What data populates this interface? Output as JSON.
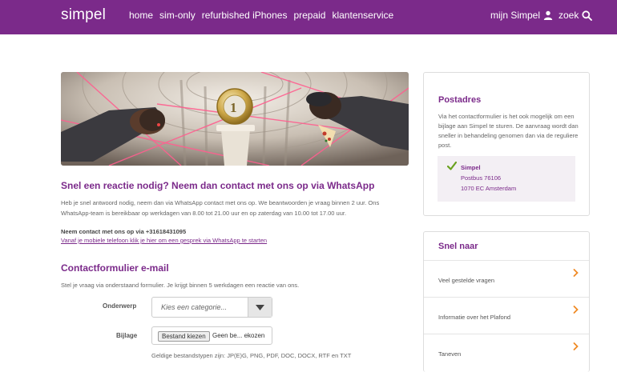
{
  "header": {
    "logo": "simpel",
    "nav": [
      "home",
      "sim-only",
      "refurbished iPhones",
      "prepaid",
      "klantenservice"
    ],
    "account_label": "mijn Simpel",
    "search_label": "zoek"
  },
  "whatsapp": {
    "title": "Snel een reactie nodig? Neem dan contact met ons op via WhatsApp",
    "intro": "Heb je snel antwoord nodig, neem dan via WhatsApp contact met ons op. We beantwoorden je vraag binnen 2 uur. Ons WhatsApp-team is bereikbaar op werkdagen van 8.00 tot 21.00 uur en op zaterdag van 10.00 tot 17.00 uur.",
    "contact": "Neem contact met ons op via +31618431095",
    "link": "Vanaf je mobiele telefoon klik je hier om een gesprek via WhatsApp te starten"
  },
  "form": {
    "title": "Contactformulier e-mail",
    "intro": "Stel je vraag via onderstaand formulier. Je krijgt binnen 5 werkdagen een reactie van ons.",
    "subject_label": "Onderwerp",
    "subject_placeholder": "Kies een categorie...",
    "attachment_label": "Bijlage",
    "file_button": "Bestand kiezen",
    "file_status": "Geen be... ekozen",
    "file_types": "Geldige bestandstypen zijn: JP(E)G, PNG, PDF, DOC, DOCX, RTF en TXT"
  },
  "postadres": {
    "title": "Postadres",
    "text": "Via het contactformulier is het ook mogelijk om een bijlage aan Simpel te sturen. De aanvraag wordt dan sneller in behandeling genomen dan via de reguliere post.",
    "name": "Simpel",
    "line1": "Postbus 76106",
    "line2": "1070 EC Amsterdam"
  },
  "snel_naar": {
    "title": "Snel naar",
    "items": [
      "Veel gestelde vragen",
      "Informatie over het Plafond",
      "Taneven"
    ]
  },
  "colors": {
    "brand": "#7b2a8a",
    "check": "#6aa11f",
    "chevron": "#f08a24"
  }
}
